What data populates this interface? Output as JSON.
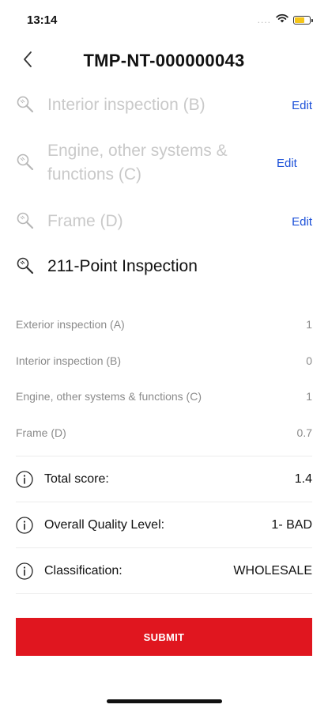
{
  "status": {
    "time": "13:14",
    "signal": "...."
  },
  "header": {
    "title": "TMP-NT-000000043"
  },
  "sections": [
    {
      "label": "Interior inspection (B)",
      "edit": "Edit"
    },
    {
      "label": "Engine, other systems & functions (C)",
      "edit": "Edit"
    },
    {
      "label": "Frame (D)",
      "edit": "Edit"
    },
    {
      "label": "211-Point Inspection"
    }
  ],
  "scores": [
    {
      "label": "Exterior inspection (A)",
      "value": "1"
    },
    {
      "label": "Interior inspection (B)",
      "value": "0"
    },
    {
      "label": "Engine, other systems & functions (C)",
      "value": "1"
    },
    {
      "label": "Frame (D)",
      "value": "0.7"
    }
  ],
  "summary": {
    "total": {
      "label": "Total score:",
      "value": "1.4"
    },
    "quality": {
      "label": "Overall Quality Level:",
      "value": "1- BAD"
    },
    "classification": {
      "label": "Classification:",
      "value": "WHOLESALE"
    }
  },
  "submit_label": "SUBMIT",
  "colors": {
    "accent": "#e0161f",
    "link": "#1a4fd8"
  }
}
